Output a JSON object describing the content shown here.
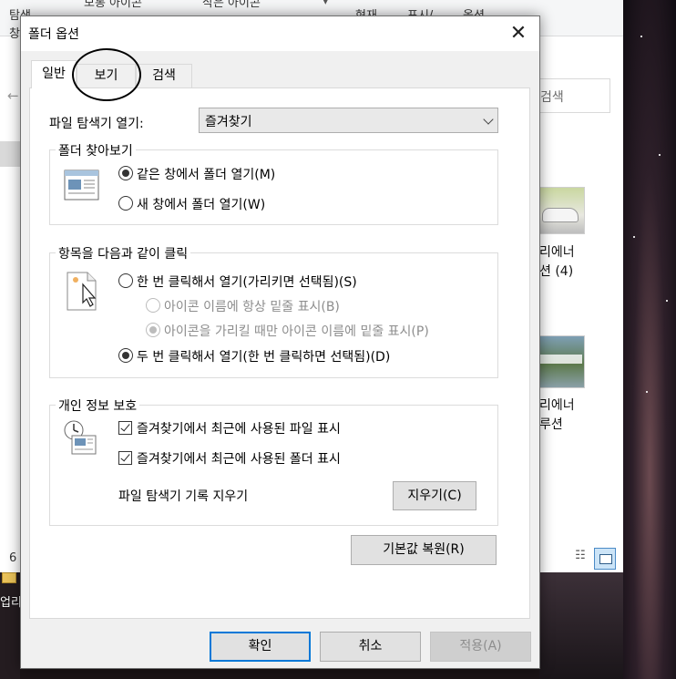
{
  "background": {
    "ribbon_left_top": "탐색",
    "ribbon_left_bottom": "창",
    "ribbon_item_1": "보통 아이콘",
    "ribbon_item_2": "작은 아이콘",
    "ribbon_item_3": "현재",
    "ribbon_item_4": "표시/",
    "ribbon_item_5": "옵션",
    "search_placeholder": "검색",
    "file_1_line1": "리에너",
    "file_1_line2": "션 (4)",
    "file_2_line1": "리에너",
    "file_2_line2": "루션",
    "status_count": "6",
    "desktop_label": "업리"
  },
  "dialog": {
    "title": "폴더 옵션",
    "close_glyph": "✕",
    "tabs": [
      {
        "label": "일반",
        "active": true
      },
      {
        "label": "보기",
        "active": false
      },
      {
        "label": "검색",
        "active": false
      }
    ],
    "open_explorer": {
      "label": "파일 탐색기 열기:",
      "value": "즐겨찾기"
    },
    "browse_folders": {
      "title": "폴더 찾아보기",
      "option_same": "같은 창에서 폴더 열기(M)",
      "option_new": "새 창에서 폴더 열기(W)",
      "selected": "same"
    },
    "click_items": {
      "title": "항목을 다음과 같이 클릭",
      "single_click": "한 번 클릭해서 열기(가리키면 선택됨)(S)",
      "underline_always": "아이콘 이름에 항상 밑줄 표시(B)",
      "underline_hover": "아이콘을 가리킬 때만 아이콘 이름에 밑줄 표시(P)",
      "double_click": "두 번 클릭해서 열기(한 번 클릭하면 선택됨)(D)",
      "selected": "double"
    },
    "privacy": {
      "title": "개인 정보 보호",
      "recent_files": "즐겨찾기에서 최근에 사용된 파일 표시",
      "recent_folders": "즐겨찾기에서 최근에 사용된 폴더 표시",
      "clear_history_label": "파일 탐색기 기록 지우기",
      "clear_button": "지우기(C)"
    },
    "restore_defaults": "기본값 복원(R)",
    "ok": "확인",
    "cancel": "취소",
    "apply": "적용(A)"
  },
  "colors": {
    "accent": "#0078d7",
    "dialog_bg": "#f0f0f0",
    "disabled_text": "#8d8d8d"
  }
}
